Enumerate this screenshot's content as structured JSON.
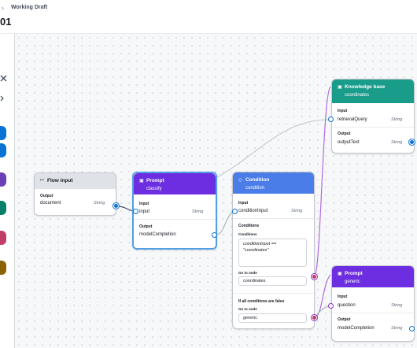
{
  "header": {
    "breadcrumb_separator": "›",
    "breadcrumb": "Working Draft",
    "title": "01"
  },
  "sidebar": {
    "close_icon": "close-icon",
    "chevron_icon": "chevron-right-icon",
    "swatches": [
      "#0972d3",
      "#0972d3",
      "#6b40b6",
      "#067f68",
      "#c33d69",
      "#8a6300"
    ]
  },
  "nodes": {
    "flow_input": {
      "icon": "↦",
      "title": "Flow input",
      "output_label": "Output",
      "field": "document",
      "type": "String",
      "header_color": "#dfe2e6"
    },
    "prompt_classify": {
      "icon": "▣",
      "title": "Prompt",
      "subtitle": "classify",
      "input_label": "Input",
      "input_field": "input",
      "input_type": "String",
      "output_label": "Output",
      "output_field": "modelCompletion",
      "header_color": "#6c2ee0"
    },
    "condition": {
      "icon": "◇",
      "title": "Condition",
      "subtitle": "condition",
      "input_label": "Input",
      "input_field": "conditionInput",
      "input_type": "String",
      "conditions_label": "Conditions",
      "conditions_sub": "Conditions",
      "expression_line1": "conditionInput ==",
      "expression_line2": "\"coordinates\"",
      "goto_label": "Go to node",
      "goto_value": "coordinates",
      "else_label": "If all conditions are false",
      "else_goto_label": "Go to node",
      "else_goto_value": "generic",
      "header_color": "#4a7de8"
    },
    "knowledge_base": {
      "icon": "▣",
      "title": "Knowledge base",
      "subtitle": "coordinates",
      "input_label": "Input",
      "input_field": "retrievalQuery",
      "input_type": "String",
      "output_label": "Output",
      "output_field": "outputText",
      "output_type": "String",
      "header_color": "#1a9c8a"
    },
    "prompt_generic": {
      "icon": "▣",
      "title": "Prompt",
      "subtitle": "generic",
      "input_label": "Input",
      "input_field": "question",
      "input_type": "String",
      "output_label": "Output",
      "output_field": "modelCompletion",
      "output_type": "String",
      "header_color": "#6c2ee0"
    }
  }
}
